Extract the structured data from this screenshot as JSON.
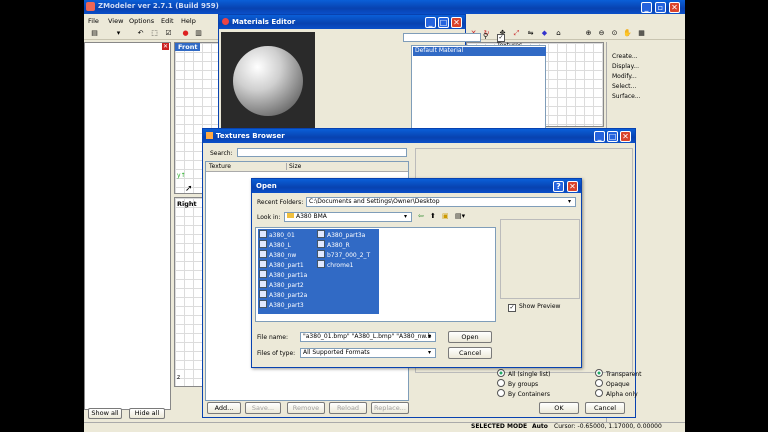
{
  "app": {
    "title": "ZModeler ver 2.7.1 (Build 959)"
  },
  "menu": [
    "File",
    "View",
    "Options",
    "Edit",
    "Help"
  ],
  "viewports": {
    "front_label": "Front",
    "right_label": "Right"
  },
  "right_panel": {
    "items": [
      "Create...",
      "Display...",
      "Modify...",
      "Select...",
      "Surface..."
    ]
  },
  "bottom_left": {
    "show_all": "Show all",
    "hide_all": "Hide all"
  },
  "status_bar": {
    "mode": "SELECTED MODE",
    "auto": "Auto",
    "cursor": "Cursor: -0.65000, 1.17000, 0.00000"
  },
  "materials_editor": {
    "title": "Materials Editor",
    "textures_label": "Textures",
    "textures_checked": true,
    "materials": [
      "Default Material"
    ]
  },
  "textures_browser": {
    "title": "Textures Browser",
    "search_label": "Search:",
    "col_texture": "Texture",
    "col_size": "Size",
    "buttons": [
      "Add...",
      "Save...",
      "Remove",
      "Reload",
      "Replace..."
    ],
    "ok": "OK",
    "cancel": "Cancel",
    "options": [
      "All (single list)",
      "By groups",
      "By Containers"
    ],
    "selected_option": "All (single list)",
    "alpha_options": [
      "Transparent",
      "Opaque",
      "Alpha only"
    ],
    "selected_alpha": "Transparent"
  },
  "open_dialog": {
    "title": "Open",
    "recent_label": "Recent Folders:",
    "recent_value": "C:\\Documents and Settings\\Owner\\Desktop",
    "lookin_label": "Look in:",
    "lookin_value": "A380 BMA",
    "files_col1": [
      "a380_01",
      "A380_L",
      "A380_nw",
      "A380_part1",
      "A380_part1a",
      "A380_part2",
      "A380_part2a",
      "A380_part3"
    ],
    "files_col2": [
      "A380_part3a",
      "A380_R",
      "b737_000_2_T",
      "chrome1"
    ],
    "show_preview_label": "Show Preview",
    "show_preview_checked": true,
    "filename_label": "File name:",
    "filename_value": "\"a380_01.bmp\" \"A380_L.bmp\" \"A380_nw.b",
    "filetype_label": "Files of type:",
    "filetype_value": "All Supported Formats",
    "open_button": "Open",
    "cancel_button": "Cancel"
  },
  "colors": {
    "xp_title": "#0a4fc8",
    "selection": "#316ac5",
    "dialog_bg": "#ece9d8"
  }
}
